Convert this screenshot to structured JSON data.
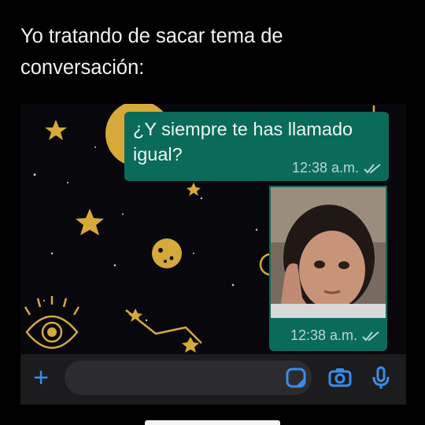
{
  "caption": {
    "line1": "Yo tratando de sacar tema de",
    "line2": "conversación:"
  },
  "chat": {
    "message": {
      "line1": "¿Y siempre te has llamado",
      "line2": "igual?",
      "time": "12:38 a.m."
    },
    "photo_message": {
      "time": "12:38 a.m."
    }
  },
  "composer": {
    "plus_label": "+"
  },
  "icons": [
    "plus-icon",
    "sticker-icon",
    "camera-icon",
    "microphone-icon",
    "double-check-icon"
  ],
  "colors": {
    "bubble": "#0b6b5a",
    "accent": "#3a8ce8",
    "gold": "#d6a93a"
  }
}
